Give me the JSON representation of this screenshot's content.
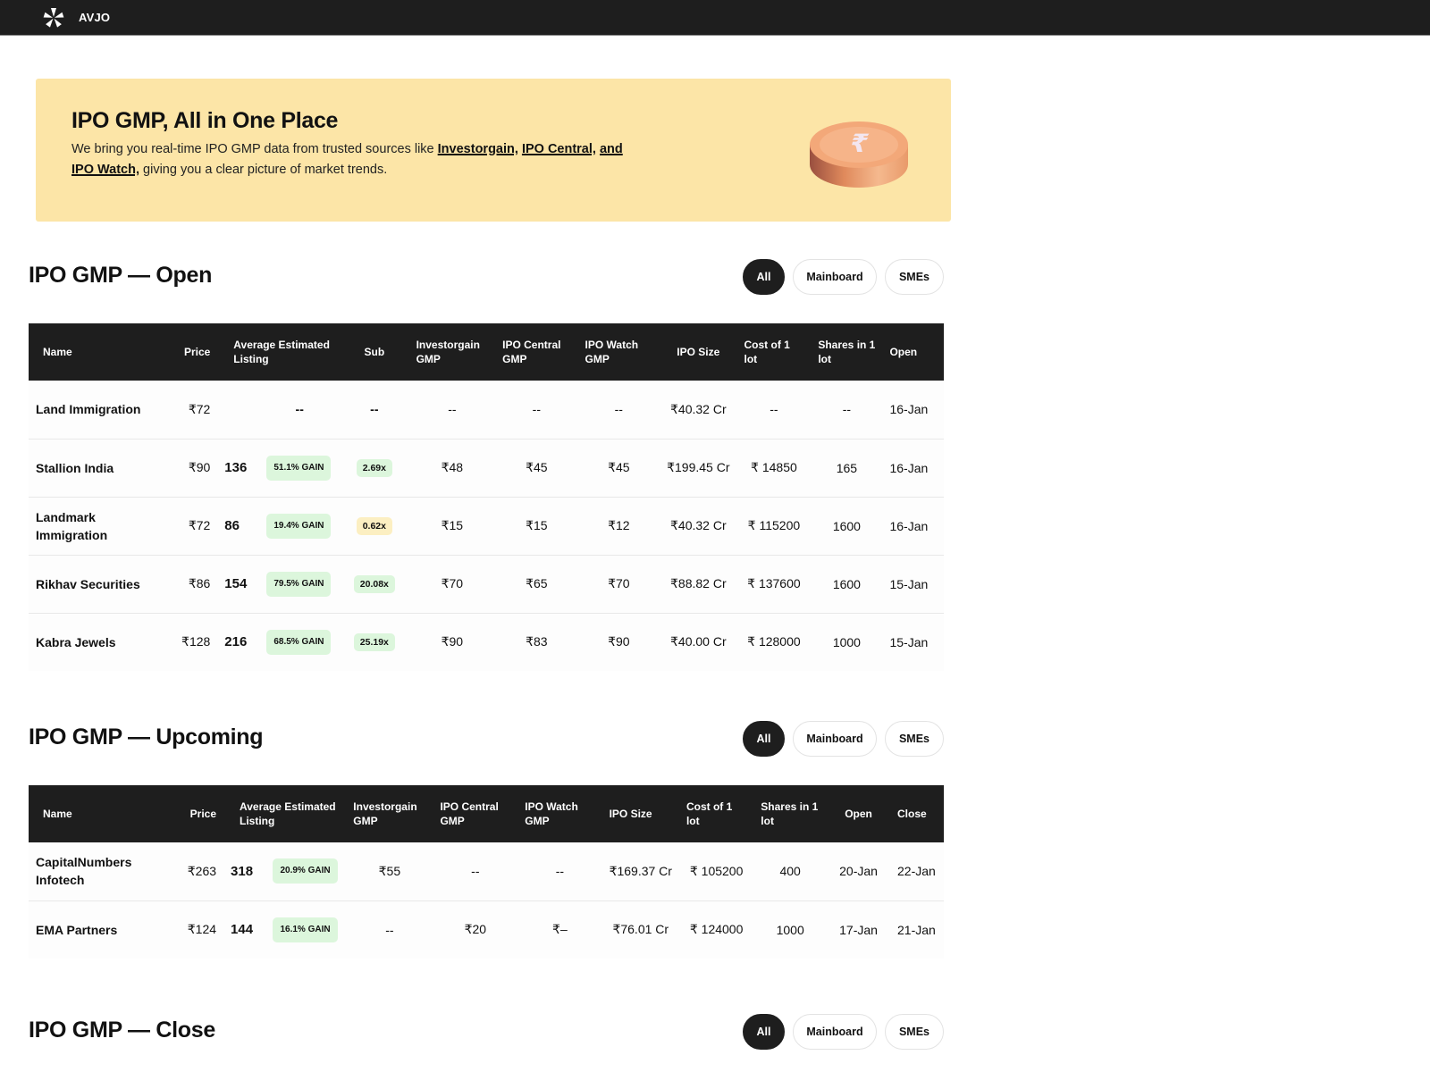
{
  "topbar": {
    "brand": "AVJO",
    "logo_icon": "pinwheel-logo-icon"
  },
  "hero": {
    "title": "IPO GMP, All in One Place",
    "text_before": "We bring you real-time IPO GMP data from trusted sources like ",
    "link1": "Investorgain,",
    "link2": "IPO Central,",
    "link3": "and IPO Watch,",
    "text_after": " giving you a clear picture of market trends.",
    "image": "rupee-coin-icon"
  },
  "filters": {
    "all": "All",
    "mainboard": "Mainboard",
    "smes": "SMEs"
  },
  "open": {
    "title": "IPO GMP — Open",
    "headers": [
      "Name",
      "Price",
      "Average Estimated Listing",
      "Sub",
      "Investorgain GMP",
      "IPO Central GMP",
      "IPO Watch GMP",
      "IPO Size",
      "Cost of 1 lot",
      "Shares in 1 lot",
      "Open"
    ],
    "rows": [
      {
        "name": "Land Immigration",
        "price": "₹72",
        "est": "",
        "gain": "--",
        "sub": "--",
        "ig": "--",
        "ic": "--",
        "iw": "--",
        "size": "₹40.32 Cr",
        "cost": "--",
        "shares": "--",
        "open": "16-Jan"
      },
      {
        "name": "Stallion India",
        "price": "₹90",
        "est": "136",
        "gain": "51.1% GAIN",
        "sub": "2.69x",
        "ig": "₹48",
        "ic": "₹45",
        "iw": "₹45",
        "size": "₹199.45 Cr",
        "cost": "₹ 14850",
        "shares": "165",
        "open": "16-Jan"
      },
      {
        "name": "Landmark Immigration",
        "price": "₹72",
        "est": "86",
        "gain": "19.4% GAIN",
        "sub": "0.62x",
        "ig": "₹15",
        "ic": "₹15",
        "iw": "₹12",
        "size": "₹40.32 Cr",
        "cost": "₹ 115200",
        "shares": "1600",
        "open": "16-Jan"
      },
      {
        "name": "Rikhav Securities",
        "price": "₹86",
        "est": "154",
        "gain": "79.5% GAIN",
        "sub": "20.08x",
        "ig": "₹70",
        "ic": "₹65",
        "iw": "₹70",
        "size": "₹88.82 Cr",
        "cost": "₹ 137600",
        "shares": "1600",
        "open": "15-Jan"
      },
      {
        "name": "Kabra Jewels",
        "price": "₹128",
        "est": "216",
        "gain": "68.5% GAIN",
        "sub": "25.19x",
        "ig": "₹90",
        "ic": "₹83",
        "iw": "₹90",
        "size": "₹40.00 Cr",
        "cost": "₹ 128000",
        "shares": "1000",
        "open": "15-Jan"
      }
    ]
  },
  "upcoming": {
    "title": "IPO GMP — Upcoming",
    "headers": [
      "Name",
      "Price",
      "Average Estimated Listing",
      "Investorgain GMP",
      "IPO Central GMP",
      "IPO Watch GMP",
      "IPO Size",
      "Cost of 1 lot",
      "Shares in 1 lot",
      "Open",
      "Close"
    ],
    "rows": [
      {
        "name": "CapitalNumbers Infotech",
        "price": "₹263",
        "est": "318",
        "gain": "20.9% GAIN",
        "ig": "₹55",
        "ic": "--",
        "iw": "--",
        "size": "₹169.37 Cr",
        "cost": "₹ 105200",
        "shares": "400",
        "open": "20-Jan",
        "close": "22-Jan"
      },
      {
        "name": "EMA Partners",
        "price": "₹124",
        "est": "144",
        "gain": "16.1% GAIN",
        "ig": "--",
        "ic": "₹20",
        "iw": "₹–",
        "size": "₹76.01 Cr",
        "cost": "₹ 124000",
        "shares": "1000",
        "open": "17-Jan",
        "close": "21-Jan"
      }
    ]
  },
  "close": {
    "title": "IPO GMP — Close"
  },
  "colors": {
    "dark": "#1e1e1e",
    "hero_bg": "#fce5a7",
    "gain_badge": "#dcf6dc",
    "low_sub_badge": "#fcefc2"
  }
}
